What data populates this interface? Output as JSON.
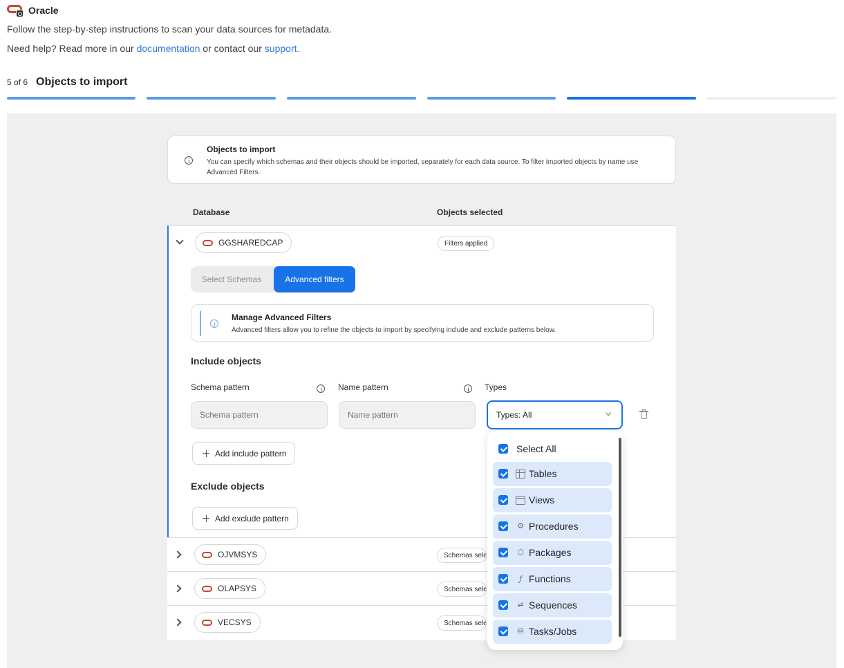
{
  "header": {
    "title": "Oracle",
    "intro": "Follow the step-by-step instructions to scan your data sources for metadata.",
    "help_prefix": "Need help? Read more in our ",
    "help_link_docs": "documentation",
    "help_middle": " or contact our ",
    "help_link_support": "support."
  },
  "step": {
    "counter": "5 of 6",
    "title": "Objects to import",
    "total_steps": 6,
    "current_step": 5,
    "completed_color": "#5b9be8",
    "current_color": "#1873e8",
    "pending_color": "#eeeeee"
  },
  "info_card": {
    "title": "Objects to import",
    "body": "You can specify which schemas and their objects should be imported, separately for each data source. To filter imported objects by name use Advanced Filters."
  },
  "table": {
    "col_database": "Database",
    "col_objects": "Objects selected",
    "rows": [
      {
        "name": "GGSHAREDCAP",
        "status": "Filters applied",
        "expanded": true
      },
      {
        "name": "OJVMSYS",
        "status": "Schemas selected",
        "expanded": false
      },
      {
        "name": "OLAPSYS",
        "status": "Schemas selected",
        "expanded": false
      },
      {
        "name": "VECSYS",
        "status": "Schemas selected",
        "expanded": false
      }
    ]
  },
  "tabs": {
    "select_schemas": "Select Schemas",
    "advanced_filters": "Advanced filters",
    "active": "advanced_filters"
  },
  "advanced_note": {
    "title": "Manage Advanced Filters",
    "body": "Advanced filters allow you to refine the objects to import by specifying include and exclude patterns below."
  },
  "include": {
    "heading": "Include objects",
    "schema_label": "Schema pattern",
    "schema_placeholder": "Schema pattern",
    "name_label": "Name pattern",
    "name_placeholder": "Name pattern",
    "types_label": "Types",
    "types_value": "Types: All",
    "add_button": "Add include pattern"
  },
  "exclude": {
    "heading": "Exclude objects",
    "add_button": "Add exclude pattern"
  },
  "types_dropdown": {
    "select_all": "Select All",
    "items": [
      {
        "label": "Tables",
        "icon": "table-icon",
        "checked": true
      },
      {
        "label": "Views",
        "icon": "view-icon",
        "checked": true
      },
      {
        "label": "Procedures",
        "icon": "gear-icon",
        "checked": true
      },
      {
        "label": "Packages",
        "icon": "package-icon",
        "checked": true
      },
      {
        "label": "Functions",
        "icon": "function-icon",
        "checked": true
      },
      {
        "label": "Sequences",
        "icon": "sequence-icon",
        "checked": true
      },
      {
        "label": "Tasks/Jobs",
        "icon": "task-icon",
        "checked": true
      }
    ]
  }
}
